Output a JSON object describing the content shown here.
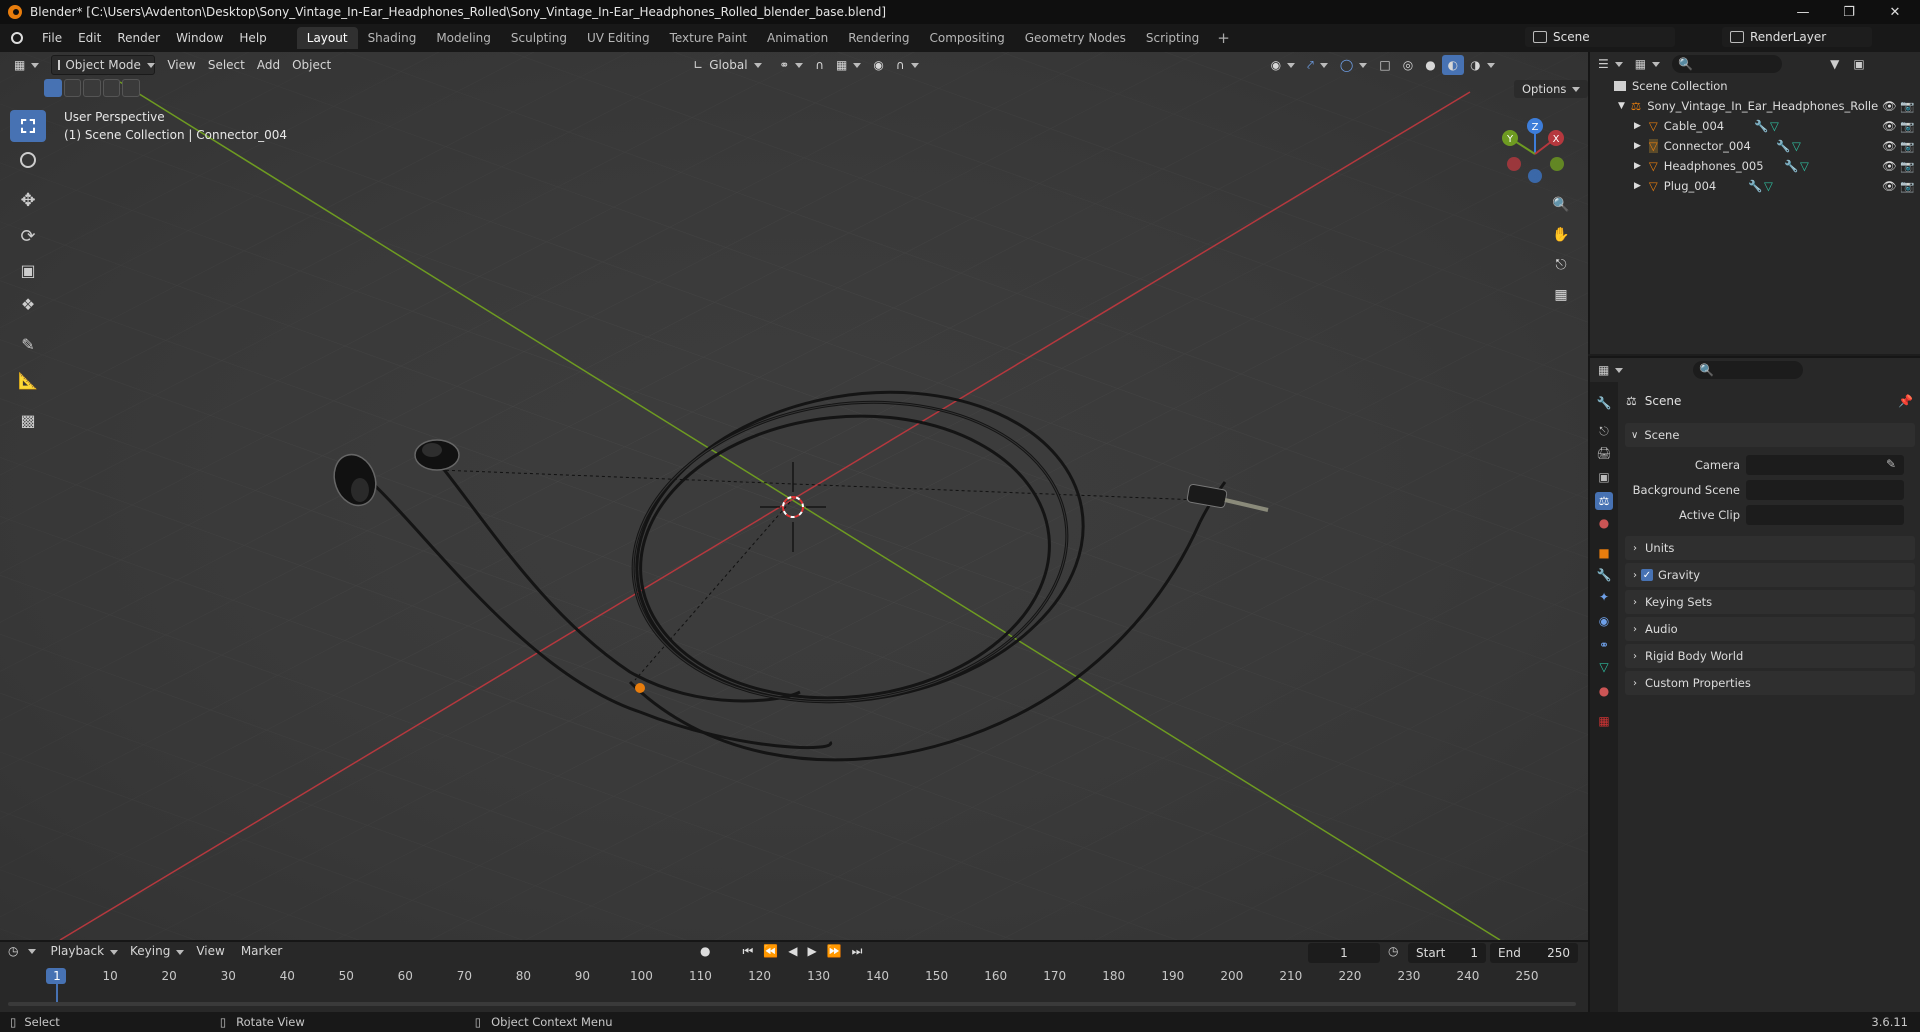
{
  "window": {
    "title": "Blender* [C:\\Users\\Avdenton\\Desktop\\Sony_Vintage_In-Ear_Headphones_Rolled\\Sony_Vintage_In-Ear_Headphones_Rolled_blender_base.blend]"
  },
  "menu": {
    "items": [
      "File",
      "Edit",
      "Render",
      "Window",
      "Help"
    ]
  },
  "workspaces": [
    "Layout",
    "Shading",
    "Modeling",
    "Sculpting",
    "UV Editing",
    "Texture Paint",
    "Animation",
    "Rendering",
    "Compositing",
    "Geometry Nodes",
    "Scripting"
  ],
  "header_right": {
    "scene": "Scene",
    "view_layer": "RenderLayer"
  },
  "viewport": {
    "mode": "Object Mode",
    "menus": [
      "View",
      "Select",
      "Add",
      "Object"
    ],
    "orientation": "Global",
    "options_label": "Options",
    "overlay_line1": "User Perspective",
    "overlay_line2": "(1) Scene Collection | Connector_004",
    "gizmo_axes": [
      "Y",
      "Z",
      "X"
    ]
  },
  "outliner": {
    "root": "Scene Collection",
    "collection": "Sony_Vintage_In_Ear_Headphones_Rolle",
    "objects": [
      "Cable_004",
      "Connector_004",
      "Headphones_005",
      "Plug_004"
    ]
  },
  "properties": {
    "context_title": "Scene",
    "panel_title": "Scene",
    "fields": [
      "Camera",
      "Background Scene",
      "Active Clip"
    ],
    "sections": [
      "Units",
      "Gravity",
      "Keying Sets",
      "Audio",
      "Rigid Body World",
      "Custom Properties"
    ],
    "gravity_checked": true
  },
  "timeline": {
    "menus": [
      "Playback",
      "Keying",
      "View",
      "Marker"
    ],
    "current_frame": "1",
    "start_label": "Start",
    "start_value": "1",
    "end_label": "End",
    "end_value": "250",
    "ticks": [
      "1",
      "10",
      "20",
      "30",
      "40",
      "50",
      "60",
      "70",
      "80",
      "90",
      "100",
      "110",
      "120",
      "130",
      "140",
      "150",
      "160",
      "170",
      "180",
      "190",
      "200",
      "210",
      "220",
      "230",
      "240",
      "250"
    ]
  },
  "statusbar": {
    "select": "Select",
    "rotate": "Rotate View",
    "context_menu": "Object Context Menu",
    "version": "3.6.11"
  },
  "colors": {
    "accent": "#4772b3",
    "x_axis": "#b5383e",
    "y_axis": "#6e9b21",
    "z_axis": "#3d7dd9",
    "object_orange": "#e87d0d"
  }
}
